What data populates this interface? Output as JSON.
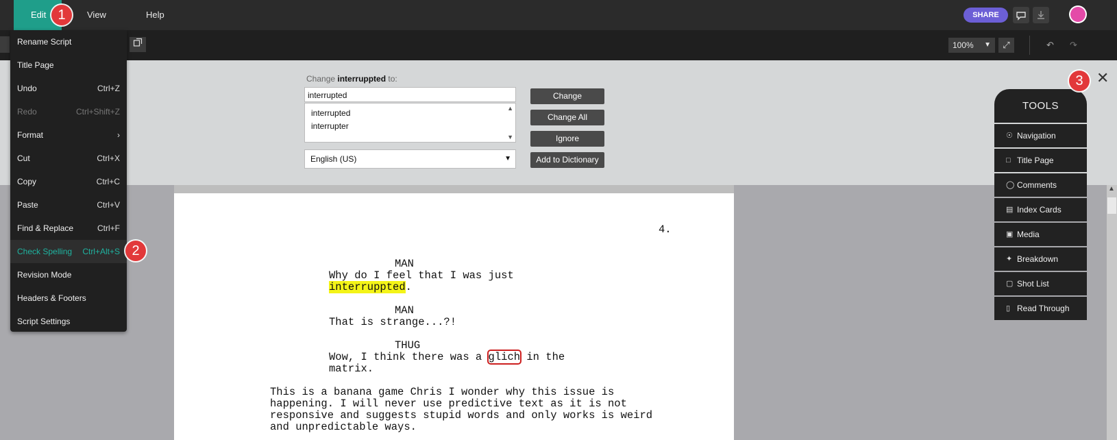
{
  "menubar": {
    "items": [
      {
        "label": "Edit",
        "active": true
      },
      {
        "label": "View",
        "active": false
      },
      {
        "label": "Help",
        "active": false
      }
    ],
    "share_label": "SHARE",
    "icons": [
      "comment-icon",
      "download-icon"
    ]
  },
  "badges": {
    "one": "1",
    "two": "2",
    "three": "3"
  },
  "toolbar": {
    "zoom": "100%",
    "icons": [
      "popout-icon",
      "expand-icon",
      "undo-icon",
      "redo-icon"
    ]
  },
  "edit_menu": {
    "items": [
      {
        "label": "Rename Script",
        "shortcut": "",
        "state": "normal"
      },
      {
        "label": "Title Page",
        "shortcut": "",
        "state": "normal"
      },
      {
        "label": "Undo",
        "shortcut": "Ctrl+Z",
        "state": "normal"
      },
      {
        "label": "Redo",
        "shortcut": "Ctrl+Shift+Z",
        "state": "disabled"
      },
      {
        "label": "Format",
        "shortcut": "›",
        "state": "normal"
      },
      {
        "label": "Cut",
        "shortcut": "Ctrl+X",
        "state": "normal"
      },
      {
        "label": "Copy",
        "shortcut": "Ctrl+C",
        "state": "normal"
      },
      {
        "label": "Paste",
        "shortcut": "Ctrl+V",
        "state": "normal"
      },
      {
        "label": "Find & Replace",
        "shortcut": "Ctrl+F",
        "state": "normal"
      },
      {
        "label": "Check Spelling",
        "shortcut": "Ctrl+Alt+S",
        "state": "active"
      },
      {
        "label": "Revision Mode",
        "shortcut": "",
        "state": "normal"
      },
      {
        "label": "Headers & Footers",
        "shortcut": "",
        "state": "normal"
      },
      {
        "label": "Script Settings",
        "shortcut": "",
        "state": "normal"
      }
    ]
  },
  "spellcheck": {
    "change_prefix": "Change",
    "word": "interruppted",
    "change_suffix": "to:",
    "replacement": "interrupted",
    "suggestions": [
      "interrupted",
      "interrupter"
    ],
    "language": "English (US)",
    "buttons": {
      "change": "Change",
      "change_all": "Change All",
      "ignore": "Ignore",
      "add_dict": "Add to Dictionary"
    }
  },
  "tools": {
    "title": "TOOLS",
    "items": [
      {
        "label": "Navigation",
        "icon": "compass-icon"
      },
      {
        "label": "Title Page",
        "icon": "page-icon"
      },
      {
        "label": "Comments",
        "icon": "comment-icon"
      },
      {
        "label": "Index Cards",
        "icon": "cards-icon"
      },
      {
        "label": "Media",
        "icon": "image-icon"
      },
      {
        "label": "Breakdown",
        "icon": "wand-icon"
      },
      {
        "label": "Shot List",
        "icon": "frame-icon"
      },
      {
        "label": "Read Through",
        "icon": "phone-icon"
      }
    ]
  },
  "script": {
    "page_number": "4.",
    "char1": "MAN",
    "line1a": "Why do I feel that I was just",
    "line1b_word": "interruppted",
    "line1b_end": ".",
    "char2": "MAN",
    "line2": "That is strange...?!",
    "char3": "THUG",
    "line3a_pre": "Wow, I think there was a ",
    "line3a_word": "glich",
    "line3a_post": " in the",
    "line3b": "matrix.",
    "action": [
      "This is a banana game Chris I wonder why this issue is",
      "happening. I will never use predictive text as it is not",
      "responsive and suggests stupid words and only works is weird",
      "and unpredictable ways."
    ]
  }
}
